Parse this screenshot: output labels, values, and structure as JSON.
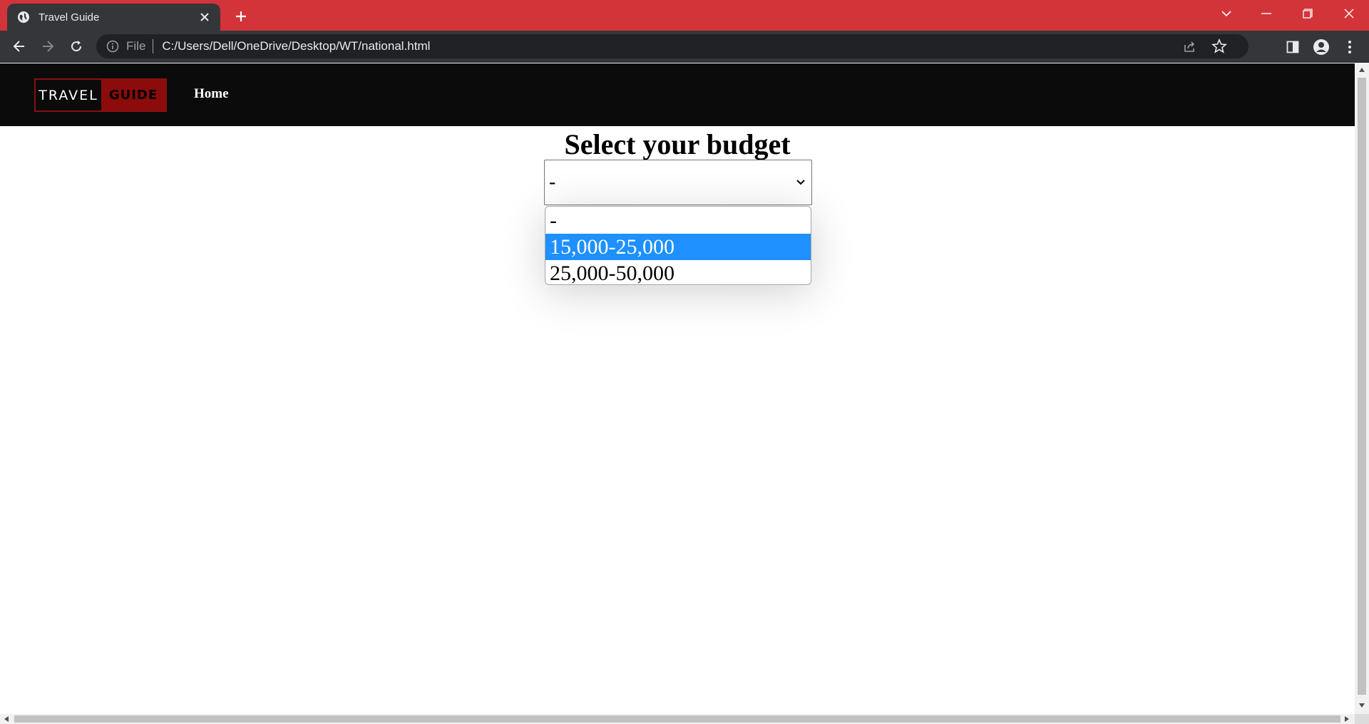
{
  "browser": {
    "tab_title": "Travel Guide",
    "address_prefix": "File",
    "url": "C:/Users/Dell/OneDrive/Desktop/WT/national.html",
    "tabstrip_color": "#d3343a"
  },
  "site": {
    "logo_left": "TRAVEL",
    "logo_right": "GUIDE",
    "nav_home": "Home"
  },
  "main": {
    "heading": "Select your budget",
    "select_value": "-",
    "options": [
      {
        "label": "-"
      },
      {
        "label": "15,000-25,000"
      },
      {
        "label": "25,000-50,000"
      }
    ],
    "highlighted_option": "15,000-25,000",
    "highlight_color": "#1e90ff"
  }
}
